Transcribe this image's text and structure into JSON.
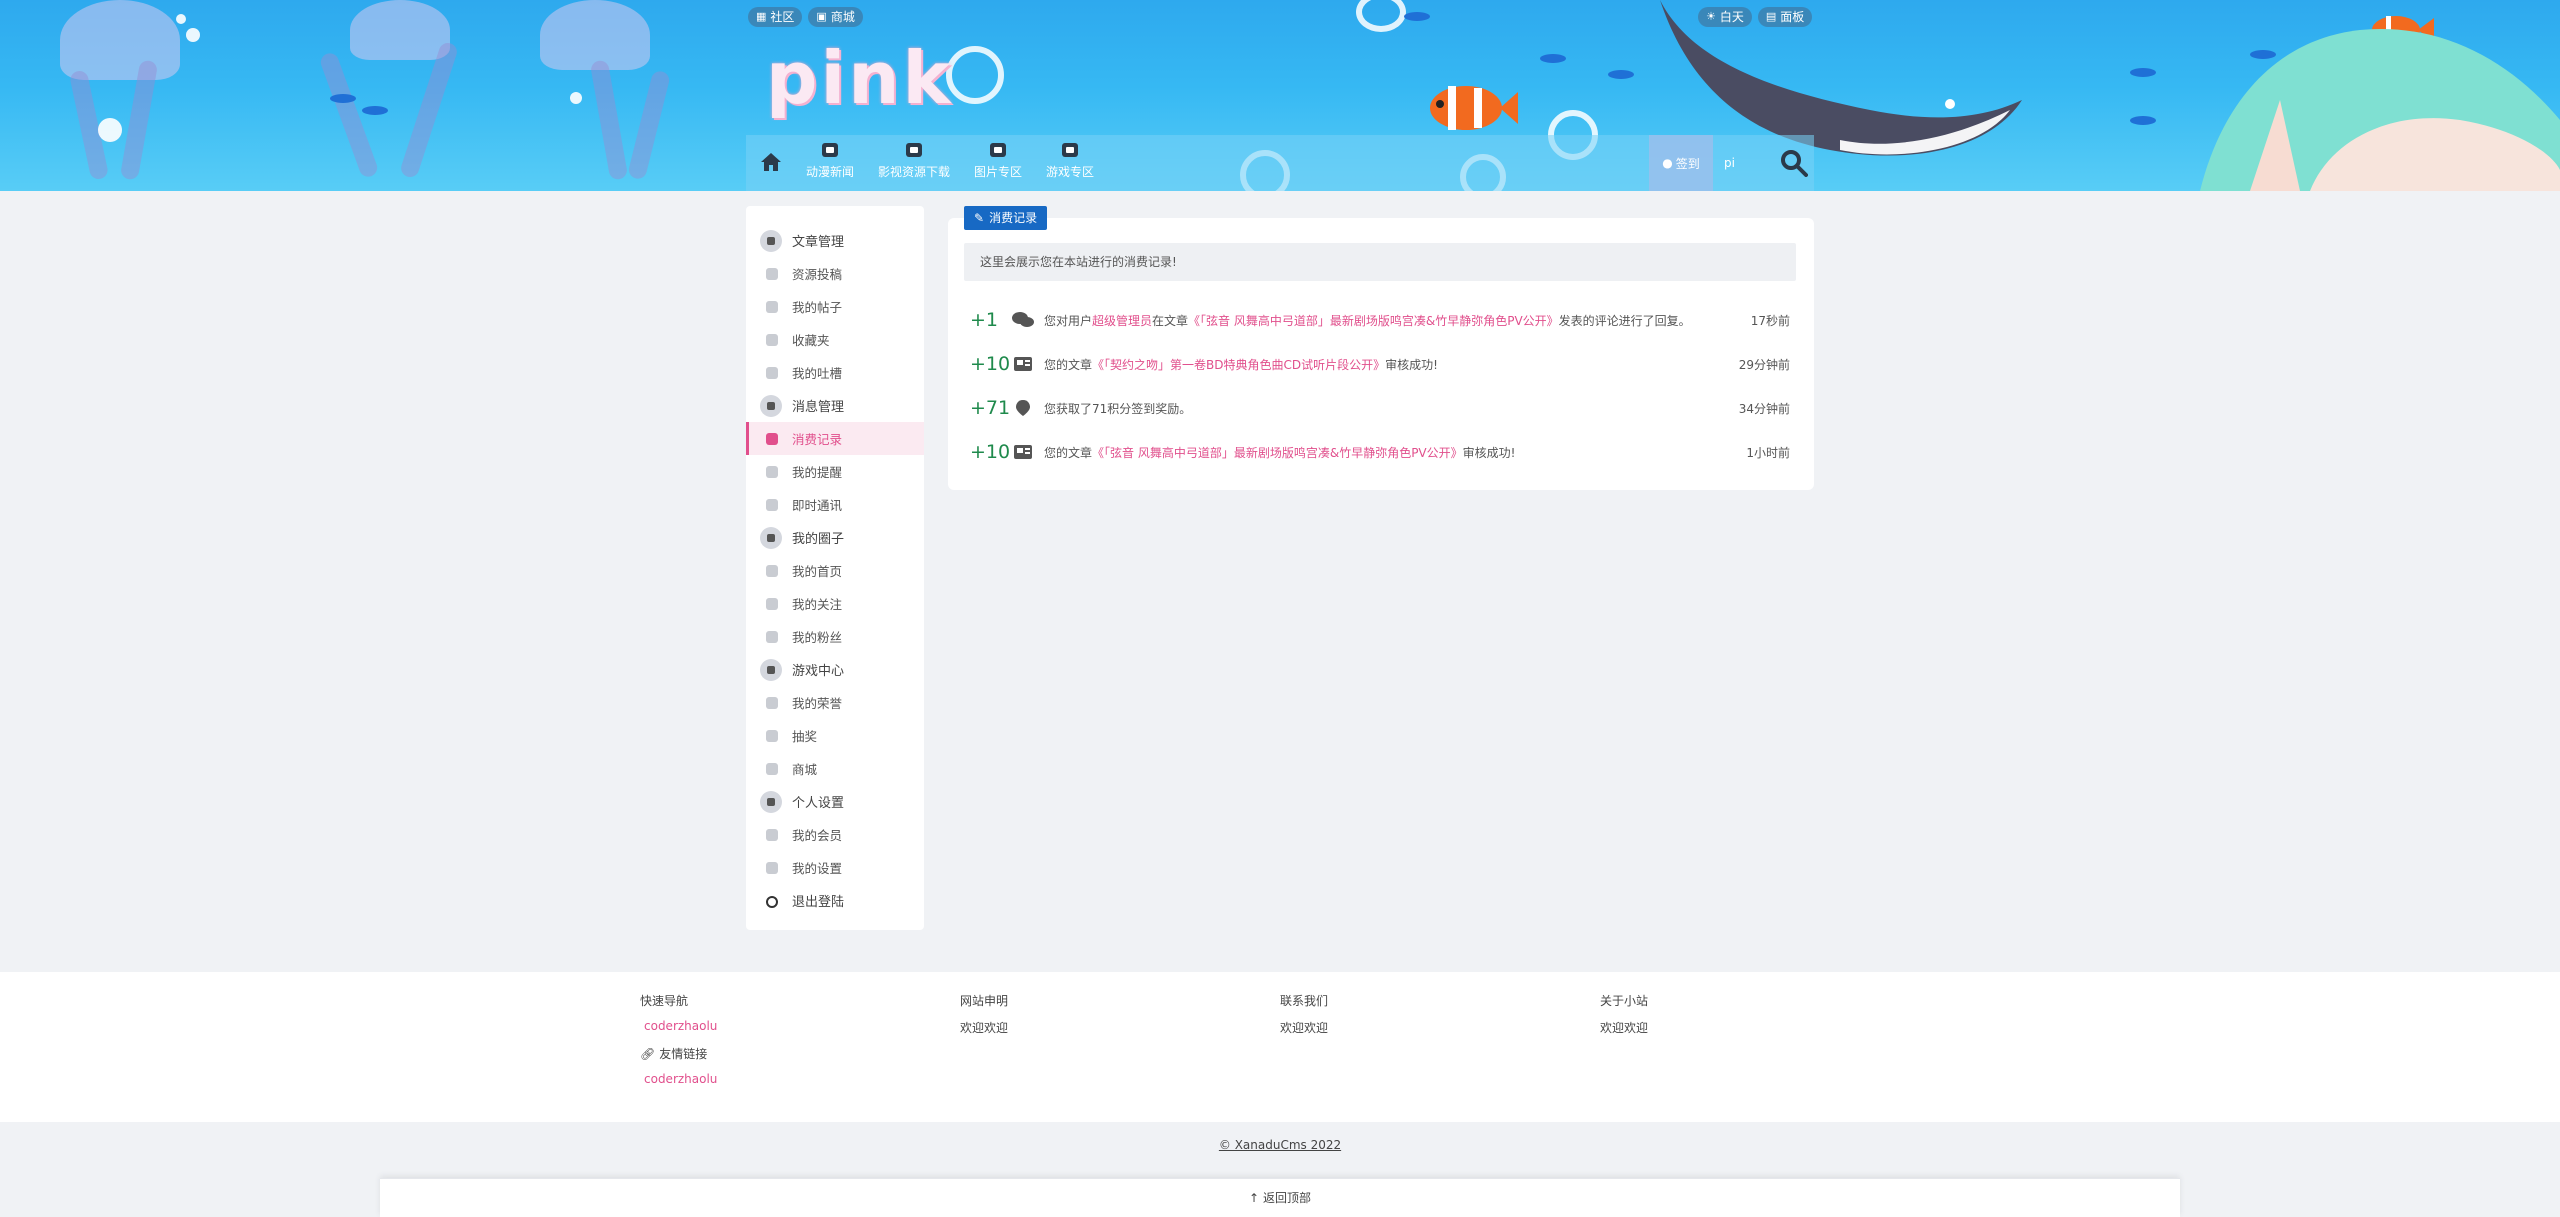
{
  "colors": {
    "accent": "#e14f8c",
    "points": "#1f8a4c",
    "tag": "#1769c4"
  },
  "header": {
    "top_left": [
      {
        "icon": "community-icon",
        "label": "社区"
      },
      {
        "icon": "shop-icon",
        "label": "商城"
      }
    ],
    "top_right": [
      {
        "icon": "sun-icon",
        "label": "白天"
      },
      {
        "icon": "id-card-icon",
        "label": "面板"
      }
    ],
    "logo_text": "pink",
    "nav": [
      {
        "icon": "news-icon",
        "label": "动漫新闻"
      },
      {
        "icon": "download-icon",
        "label": "影视资源下载"
      },
      {
        "icon": "image-icon",
        "label": "图片专区"
      },
      {
        "icon": "gamepad-icon",
        "label": "游戏专区"
      }
    ],
    "checkin": "签到",
    "user": "pi"
  },
  "sidebar": {
    "items": [
      {
        "type": "group",
        "icon": "brush-icon",
        "label": "文章管理"
      },
      {
        "type": "item",
        "icon": "pencil-icon",
        "label": "资源投稿"
      },
      {
        "type": "item",
        "icon": "posts-icon",
        "label": "我的帖子"
      },
      {
        "type": "item",
        "icon": "heart-icon",
        "label": "收藏夹"
      },
      {
        "type": "item",
        "icon": "comments-icon",
        "label": "我的吐槽"
      },
      {
        "type": "group",
        "icon": "bell-icon",
        "label": "消息管理"
      },
      {
        "type": "item",
        "icon": "history-icon",
        "label": "消费记录",
        "active": true
      },
      {
        "type": "item",
        "icon": "bell-small-icon",
        "label": "我的提醒"
      },
      {
        "type": "item",
        "icon": "envelope-icon",
        "label": "即时通讯"
      },
      {
        "type": "group",
        "icon": "circle-icon",
        "label": "我的圈子"
      },
      {
        "type": "item",
        "icon": "home-circle-icon",
        "label": "我的首页"
      },
      {
        "type": "item",
        "icon": "users-icon",
        "label": "我的关注"
      },
      {
        "type": "item",
        "icon": "fans-icon",
        "label": "我的粉丝"
      },
      {
        "type": "group",
        "icon": "gamepad-icon",
        "label": "游戏中心"
      },
      {
        "type": "item",
        "icon": "bookmark-icon",
        "label": "我的荣誉"
      },
      {
        "type": "item",
        "icon": "gift-icon",
        "label": "抽奖"
      },
      {
        "type": "item",
        "icon": "store-icon",
        "label": "商城"
      },
      {
        "type": "group",
        "icon": "profile-card-icon",
        "label": "个人设置"
      },
      {
        "type": "item",
        "icon": "member-card-icon",
        "label": "我的会员"
      },
      {
        "type": "item",
        "icon": "gear-icon",
        "label": "我的设置"
      },
      {
        "type": "group",
        "icon": "power-icon",
        "label": "退出登陆",
        "logout": true
      }
    ]
  },
  "main": {
    "tag": "消费记录",
    "notice": "这里会展示您在本站进行的消费记录!",
    "records": [
      {
        "points": "+1",
        "icon": "comments-icon",
        "prefix": "您对用户",
        "user": "超级管理员",
        "mid": "在文章",
        "link": "《「弦音 风舞高中弓道部」最新剧场版鸣宫凑&竹早静弥角色PV公开》",
        "suffix": "发表的评论进行了回复。",
        "time": "17秒前"
      },
      {
        "points": "+10",
        "icon": "newspaper-icon",
        "prefix": "您的文章",
        "user": "",
        "mid": "",
        "link": "《「契约之吻」第一卷BD特典角色曲CD试听片段公开》",
        "suffix": "审核成功!",
        "time": "29分钟前"
      },
      {
        "points": "+71",
        "icon": "map-pin-icon",
        "prefix": "您获取了71积分签到奖励。",
        "user": "",
        "mid": "",
        "link": "",
        "suffix": "",
        "time": "34分钟前"
      },
      {
        "points": "+10",
        "icon": "newspaper-icon",
        "prefix": "您的文章",
        "user": "",
        "mid": "",
        "link": "《「弦音 风舞高中弓道部」最新剧场版鸣宫凑&竹早静弥角色PV公开》",
        "suffix": "审核成功!",
        "time": "1小时前"
      }
    ]
  },
  "footer": {
    "columns": [
      {
        "heading": "快速导航",
        "link": "coderzhaolu",
        "friends_label": "友情链接",
        "friends_link": "coderzhaolu"
      },
      {
        "heading": "网站申明",
        "text": "欢迎欢迎"
      },
      {
        "heading": "联系我们",
        "text": "欢迎欢迎"
      },
      {
        "heading": "关于小站",
        "text": "欢迎欢迎"
      }
    ],
    "copyright": "© XanaduCms 2022",
    "back_to_top": "返回顶部"
  }
}
